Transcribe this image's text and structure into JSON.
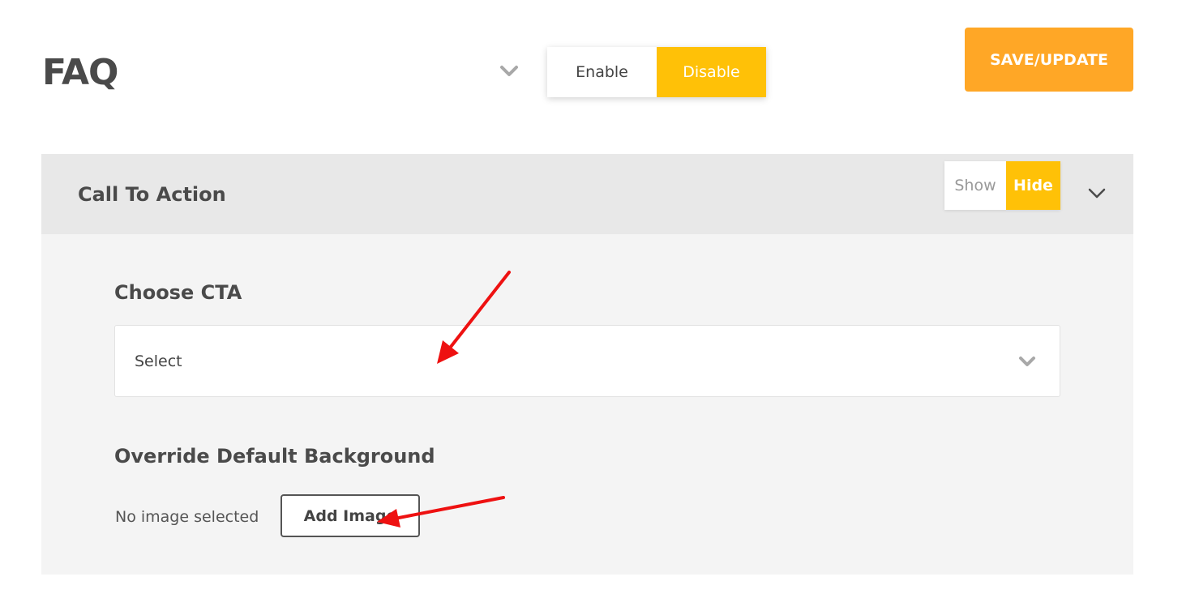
{
  "header": {
    "title": "FAQ",
    "status_toggle": {
      "enable_label": "Enable",
      "disable_label": "Disable",
      "selected": "Disable"
    },
    "save_label": "SAVE/UPDATE"
  },
  "section": {
    "title": "Call To Action",
    "visibility_toggle": {
      "show_label": "Show",
      "hide_label": "Hide",
      "selected": "Hide"
    },
    "choose_cta": {
      "label": "Choose CTA",
      "selected_value": "Select"
    },
    "background": {
      "label": "Override Default Background",
      "status_text": "No image selected",
      "add_image_label": "Add Image"
    }
  },
  "icons": {
    "title_chevron": "chevron-down-icon",
    "section_chevron": "chevron-down-icon",
    "select_chevron": "chevron-down-icon"
  },
  "colors": {
    "accent_yellow": "#ffc107",
    "save_orange": "#ffa726",
    "annotation_red": "#ee1111"
  }
}
